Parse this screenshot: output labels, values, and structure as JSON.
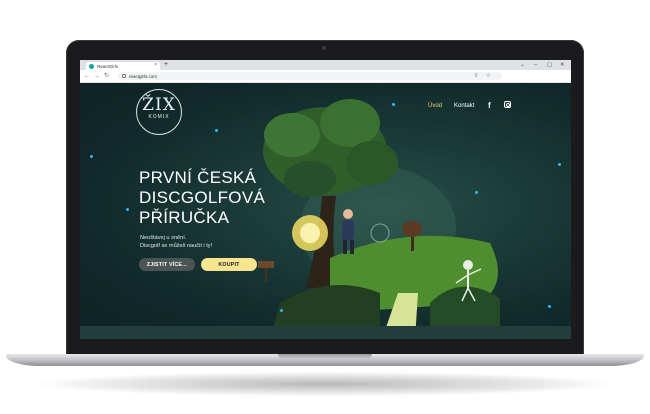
{
  "browser": {
    "tab_title": "ReactGirls",
    "tab_close": "×",
    "new_tab": "+",
    "window_controls": [
      "⌄",
      "–",
      "▢",
      "✕"
    ],
    "nav": {
      "back": "←",
      "forward": "→",
      "reload": "↻"
    },
    "url": "reactgirls.com",
    "omnibox_icons": [
      "⇪",
      "☆"
    ]
  },
  "site": {
    "logo": {
      "main": "ŽIX",
      "sub": "KOMIX"
    },
    "nav": {
      "home": "Úvod",
      "contact": "Kontakt"
    },
    "social": {
      "facebook": "f"
    },
    "hero": {
      "title_lines": [
        "PRVNÍ ČESKÁ",
        "DISCGOLFOVÁ",
        "PŘÍRUČKA"
      ],
      "subtitle_lines": [
        "Neoštávej u snění.",
        "Discgolf se můžeš naučit i ty!"
      ],
      "more_label": "ZJISTIT VÍCE...",
      "buy_label": "KOUPIT"
    }
  },
  "colors": {
    "accent_yellow": "#f7e68f",
    "nav_active": "#f3d66b",
    "bg_dark": "#11292a",
    "dot_blue": "#2bb7ff"
  }
}
